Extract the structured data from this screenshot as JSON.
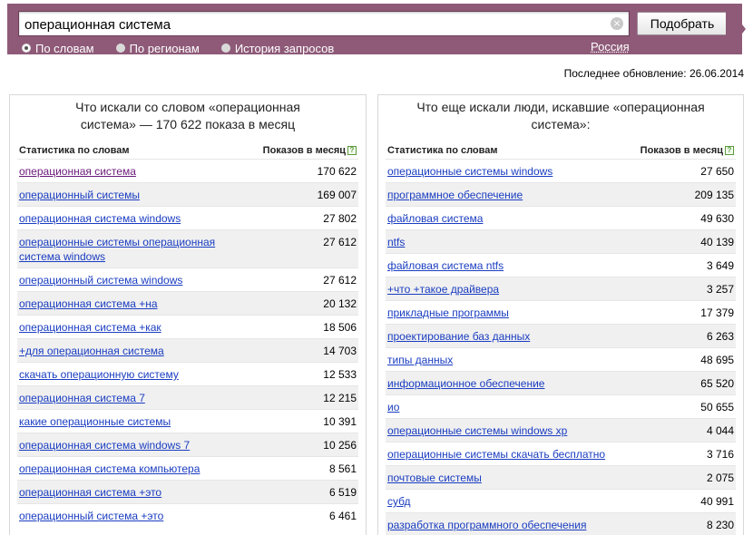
{
  "search": {
    "query": "операционная система",
    "submit_label": "Подобрать"
  },
  "modes": [
    {
      "label": "По словам",
      "checked": true
    },
    {
      "label": "По регионам",
      "checked": false
    },
    {
      "label": "История запросов",
      "checked": false
    }
  ],
  "region": "Россия",
  "updated": "Последнее обновление: 26.06.2014",
  "left_panel": {
    "title": "Что искали со словом «операционная система» — 170 622 показа в месяц",
    "col_words": "Статистика по словам",
    "col_count": "Показов в месяц",
    "rows": [
      {
        "phrase": "операционная система",
        "count": "170 622"
      },
      {
        "phrase": "операционный системы",
        "count": "169 007"
      },
      {
        "phrase": "операционная система windows",
        "count": "27 802"
      },
      {
        "phrase": "операционные системы операционная система windows",
        "count": "27 612"
      },
      {
        "phrase": "операционный система windows",
        "count": "27 612"
      },
      {
        "phrase": "операционная система +на",
        "count": "20 132"
      },
      {
        "phrase": "операционная система +как",
        "count": "18 506"
      },
      {
        "phrase": "+для операционная система",
        "count": "14 703"
      },
      {
        "phrase": "скачать операционную систему",
        "count": "12 533"
      },
      {
        "phrase": "операционная система 7",
        "count": "12 215"
      },
      {
        "phrase": "какие операционные системы",
        "count": "10 391"
      },
      {
        "phrase": "операционная система windows 7",
        "count": "10 256"
      },
      {
        "phrase": "операционная система компьютера",
        "count": "8 561"
      },
      {
        "phrase": "операционная система +это",
        "count": "6 519"
      },
      {
        "phrase": "операционный система +это",
        "count": "6 461"
      }
    ]
  },
  "right_panel": {
    "title": "Что еще искали люди, искавшие «операционная система»:",
    "col_words": "Статистика по словам",
    "col_count": "Показов в месяц",
    "rows": [
      {
        "phrase": "операционные системы windows",
        "count": "27 650"
      },
      {
        "phrase": "программное обеспечение",
        "count": "209 135"
      },
      {
        "phrase": "файловая система",
        "count": "49 630"
      },
      {
        "phrase": "ntfs",
        "count": "40 139"
      },
      {
        "phrase": "файловая система ntfs",
        "count": "3 649"
      },
      {
        "phrase": "+что +такое драйвера",
        "count": "3 257"
      },
      {
        "phrase": "прикладные программы",
        "count": "17 379"
      },
      {
        "phrase": "проектирование баз данных",
        "count": "6 263"
      },
      {
        "phrase": "типы данных",
        "count": "48 695"
      },
      {
        "phrase": "информационное обеспечение",
        "count": "65 520"
      },
      {
        "phrase": "ио",
        "count": "50 655"
      },
      {
        "phrase": "операционные системы windows xp",
        "count": "4 044"
      },
      {
        "phrase": "операционные системы скачать бесплатно",
        "count": "3 716"
      },
      {
        "phrase": "почтовые системы",
        "count": "2 075"
      },
      {
        "phrase": "субд",
        "count": "40 991"
      },
      {
        "phrase": "разработка программного обеспечения",
        "count": "8 230"
      }
    ]
  }
}
